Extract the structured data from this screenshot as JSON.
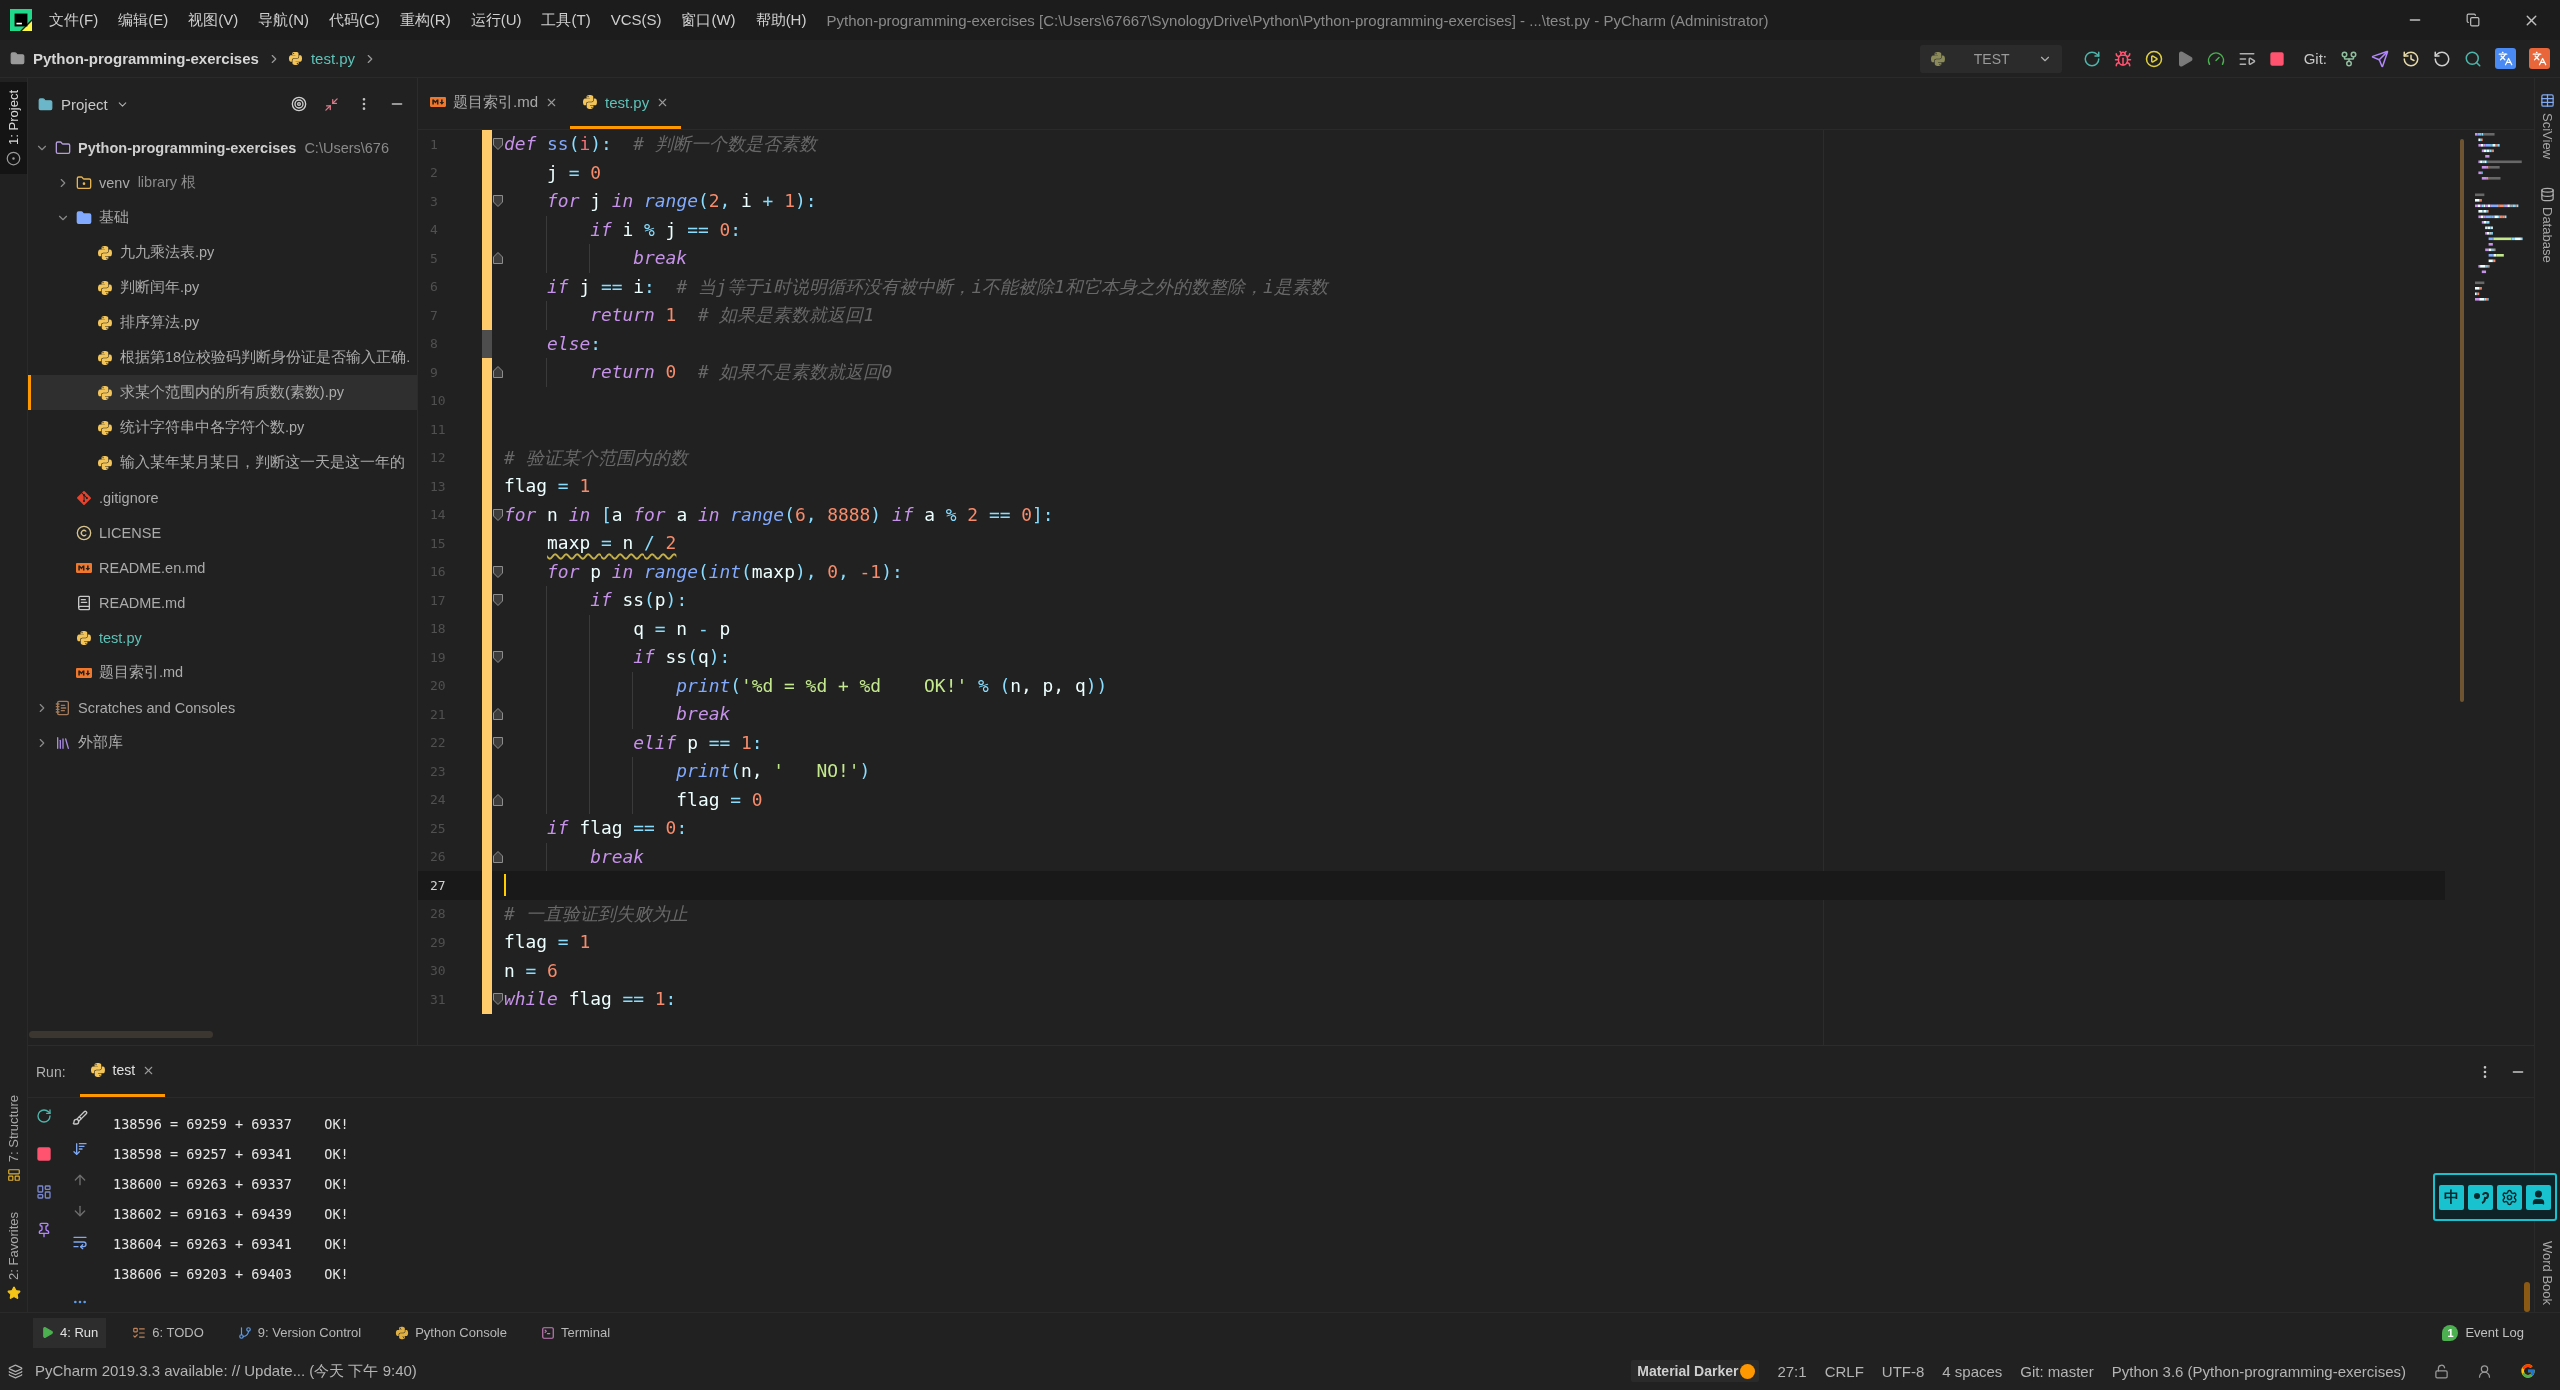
{
  "menu_bar": {
    "menus": [
      "文件(F)",
      "编辑(E)",
      "视图(V)",
      "导航(N)",
      "代码(C)",
      "重构(R)",
      "运行(U)",
      "工具(T)",
      "VCS(S)",
      "窗口(W)",
      "帮助(H)"
    ],
    "title": "Python-programming-exercises [C:\\Users\\67667\\SynologyDrive\\Python\\Python-programming-exercises] - ...\\test.py - PyCharm (Administrator)"
  },
  "nav_bar": {
    "breadcrumbs": [
      {
        "label": "Python-programming-exercises",
        "kind": "folder",
        "modified": false
      },
      {
        "label": "test.py",
        "kind": "python",
        "modified": true
      }
    ],
    "run_config": "TEST",
    "vcs_label": "Git:"
  },
  "left_stripe": {
    "top": [
      {
        "label": "1: Project",
        "selected": true
      }
    ],
    "bottom": [
      {
        "label": "7: Structure",
        "selected": false
      },
      {
        "label": "2: Favorites",
        "selected": false
      }
    ]
  },
  "right_stripe": {
    "top": [
      "SciView",
      "Database"
    ],
    "bottom": [
      "Word Book"
    ]
  },
  "project_panel": {
    "title": "Project",
    "tree": [
      {
        "label": "Python-programming-exercises",
        "path": "C:\\Users\\676",
        "kind": "module",
        "expanded": true,
        "selected": false,
        "modified": false,
        "children": [
          {
            "label": "venv",
            "note": "library 根",
            "kind": "excluded",
            "expanded": false,
            "selected": false,
            "modified": false
          },
          {
            "label": "基础",
            "kind": "folder",
            "expanded": true,
            "selected": false,
            "modified": false,
            "children": [
              {
                "label": "九九乘法表.py",
                "kind": "python",
                "selected": false,
                "modified": false
              },
              {
                "label": "判断闰年.py",
                "kind": "python",
                "selected": false,
                "modified": false
              },
              {
                "label": "排序算法.py",
                "kind": "python",
                "selected": false,
                "modified": false
              },
              {
                "label": "根据第18位校验码判断身份证是否输入正确.",
                "kind": "python",
                "selected": false,
                "modified": false
              },
              {
                "label": "求某个范围内的所有质数(素数).py",
                "kind": "python",
                "selected": true,
                "modified": false
              },
              {
                "label": "统计字符串中各字符个数.py",
                "kind": "python",
                "selected": false,
                "modified": false
              },
              {
                "label": "输入某年某月某日，判断这一天是这一年的",
                "kind": "python",
                "selected": false,
                "modified": false
              }
            ]
          },
          {
            "label": ".gitignore",
            "kind": "git",
            "selected": false,
            "modified": false
          },
          {
            "label": "LICENSE",
            "kind": "license",
            "selected": false,
            "modified": false
          },
          {
            "label": "README.en.md",
            "kind": "markdown",
            "selected": false,
            "modified": false
          },
          {
            "label": "README.md",
            "kind": "readme",
            "selected": false,
            "modified": false
          },
          {
            "label": "test.py",
            "kind": "python",
            "selected": false,
            "modified": true
          },
          {
            "label": "题目索引.md",
            "kind": "markdown",
            "selected": false,
            "modified": false
          }
        ]
      },
      {
        "label": "Scratches and Consoles",
        "kind": "scratches",
        "expanded": false,
        "selected": false,
        "modified": false
      },
      {
        "label": "外部库",
        "kind": "library",
        "expanded": false,
        "selected": false,
        "modified": false
      }
    ]
  },
  "editor": {
    "tabs": [
      {
        "label": "题目索引.md",
        "kind": "markdown",
        "selected": false,
        "modified": false
      },
      {
        "label": "test.py",
        "kind": "python",
        "selected": true,
        "modified": true
      }
    ],
    "lines": [
      {
        "number": "1",
        "current": false,
        "warning": false,
        "fold_marker": {
          "kind": "start"
        },
        "change_marker": {
          "color": "#ffcb6b"
        },
        "tokens": [
          {
            "kind": "keyword",
            "text": "def"
          },
          {
            "kind": "function",
            "text": " ss"
          },
          {
            "kind": "punct",
            "text": "("
          },
          {
            "kind": "param",
            "text": "i"
          },
          {
            "kind": "punct",
            "text": "):"
          },
          {
            "kind": "comment",
            "text": "  # 判断一个数是否素数"
          }
        ]
      },
      {
        "number": "2",
        "current": false,
        "warning": false,
        "change_marker": {
          "color": "#ffcb6b"
        },
        "tokens": [
          {
            "kind": "plain",
            "text": "    j "
          },
          {
            "kind": "punct",
            "text": "="
          },
          {
            "kind": "number",
            "text": " 0"
          }
        ]
      },
      {
        "number": "3",
        "current": false,
        "warning": false,
        "fold_marker": {
          "kind": "start"
        },
        "change_marker": {
          "color": "#ffcb6b"
        },
        "tokens": [
          {
            "kind": "keyword",
            "text": "    for"
          },
          {
            "kind": "plain",
            "text": " j "
          },
          {
            "kind": "keyword",
            "text": "in"
          },
          {
            "kind": "builtin",
            "text": " range"
          },
          {
            "kind": "punct",
            "text": "("
          },
          {
            "kind": "number",
            "text": "2"
          },
          {
            "kind": "punct",
            "text": ","
          },
          {
            "kind": "plain",
            "text": " i "
          },
          {
            "kind": "punct",
            "text": "+"
          },
          {
            "kind": "number",
            "text": " 1"
          },
          {
            "kind": "punct",
            "text": "):"
          }
        ]
      },
      {
        "number": "4",
        "current": false,
        "warning": false,
        "change_marker": {
          "color": "#ffcb6b"
        },
        "tokens": [
          {
            "kind": "keyword",
            "text": "        if"
          },
          {
            "kind": "plain",
            "text": " i "
          },
          {
            "kind": "punct",
            "text": "%"
          },
          {
            "kind": "plain",
            "text": " j "
          },
          {
            "kind": "punct",
            "text": "=="
          },
          {
            "kind": "number",
            "text": " 0"
          },
          {
            "kind": "punct",
            "text": ":"
          }
        ]
      },
      {
        "number": "5",
        "current": false,
        "warning": false,
        "fold_marker": {
          "kind": "end"
        },
        "change_marker": {
          "color": "#ffcb6b"
        },
        "tokens": [
          {
            "kind": "keyword",
            "text": "            break"
          }
        ]
      },
      {
        "number": "6",
        "current": false,
        "warning": false,
        "change_marker": {
          "color": "#ffcb6b"
        },
        "tokens": [
          {
            "kind": "keyword",
            "text": "    if"
          },
          {
            "kind": "plain",
            "text": " j "
          },
          {
            "kind": "punct",
            "text": "=="
          },
          {
            "kind": "plain",
            "text": " i"
          },
          {
            "kind": "punct",
            "text": ":"
          },
          {
            "kind": "comment",
            "text": "  # 当j等于i时说明循环没有被中断，i不能被除1和它本身之外的数整除，i是素数"
          }
        ]
      },
      {
        "number": "7",
        "current": false,
        "warning": false,
        "change_marker": {
          "color": "#ffcb6b"
        },
        "tokens": [
          {
            "kind": "keyword",
            "text": "        return"
          },
          {
            "kind": "number",
            "text": " 1"
          },
          {
            "kind": "comment",
            "text": "  # 如果是素数就返回1"
          }
        ]
      },
      {
        "number": "8",
        "current": false,
        "warning": false,
        "change_marker": {
          "color": "#4d4d4d"
        },
        "tokens": [
          {
            "kind": "keyword",
            "text": "    else"
          },
          {
            "kind": "punct",
            "text": ":"
          }
        ]
      },
      {
        "number": "9",
        "current": false,
        "warning": false,
        "fold_marker": {
          "kind": "end"
        },
        "change_marker": {
          "color": "#ffcb6b"
        },
        "tokens": [
          {
            "kind": "keyword",
            "text": "        return"
          },
          {
            "kind": "number",
            "text": " 0"
          },
          {
            "kind": "comment",
            "text": "  # 如果不是素数就返回0"
          }
        ]
      },
      {
        "number": "10",
        "current": false,
        "change_marker": {
          "color": "#ffcb6b"
        }
      },
      {
        "number": "11",
        "current": false,
        "change_marker": {
          "color": "#ffcb6b"
        }
      },
      {
        "number": "12",
        "current": false,
        "warning": false,
        "change_marker": {
          "color": "#ffcb6b"
        },
        "tokens": [
          {
            "kind": "comment",
            "text": "# 验证某个范围内的数"
          }
        ]
      },
      {
        "number": "13",
        "current": false,
        "warning": false,
        "change_marker": {
          "color": "#ffcb6b"
        },
        "tokens": [
          {
            "kind": "plain",
            "text": "flag "
          },
          {
            "kind": "punct",
            "text": "="
          },
          {
            "kind": "number",
            "text": " 1"
          }
        ]
      },
      {
        "number": "14",
        "current": false,
        "warning": false,
        "fold_marker": {
          "kind": "start"
        },
        "change_marker": {
          "color": "#ffcb6b"
        },
        "tokens": [
          {
            "kind": "keyword",
            "text": "for"
          },
          {
            "kind": "plain",
            "text": " n "
          },
          {
            "kind": "keyword",
            "text": "in"
          },
          {
            "kind": "punct",
            "text": " ["
          },
          {
            "kind": "plain",
            "text": "a "
          },
          {
            "kind": "keyword",
            "text": "for"
          },
          {
            "kind": "plain",
            "text": " a "
          },
          {
            "kind": "keyword",
            "text": "in"
          },
          {
            "kind": "builtin",
            "text": " range"
          },
          {
            "kind": "punct",
            "text": "("
          },
          {
            "kind": "number",
            "text": "6"
          },
          {
            "kind": "punct",
            "text": ","
          },
          {
            "kind": "number",
            "text": " 8888"
          },
          {
            "kind": "punct",
            "text": ")"
          },
          {
            "kind": "keyword",
            "text": " if"
          },
          {
            "kind": "plain",
            "text": " a "
          },
          {
            "kind": "punct",
            "text": "%"
          },
          {
            "kind": "number",
            "text": " 2"
          },
          {
            "kind": "punct",
            "text": " =="
          },
          {
            "kind": "number",
            "text": " 0"
          },
          {
            "kind": "punct",
            "text": "]:"
          }
        ]
      },
      {
        "number": "15",
        "current": false,
        "warning": true,
        "change_marker": {
          "color": "#ffcb6b"
        },
        "tokens": [
          {
            "kind": "plain",
            "text": "    maxp "
          },
          {
            "kind": "punct",
            "text": "="
          },
          {
            "kind": "plain",
            "text": " n "
          },
          {
            "kind": "punct",
            "text": "/"
          },
          {
            "kind": "number",
            "text": " 2"
          }
        ]
      },
      {
        "number": "16",
        "current": false,
        "warning": false,
        "fold_marker": {
          "kind": "start"
        },
        "change_marker": {
          "color": "#ffcb6b"
        },
        "tokens": [
          {
            "kind": "keyword",
            "text": "    for"
          },
          {
            "kind": "plain",
            "text": " p "
          },
          {
            "kind": "keyword",
            "text": "in"
          },
          {
            "kind": "builtin",
            "text": " range"
          },
          {
            "kind": "punct",
            "text": "("
          },
          {
            "kind": "builtin",
            "text": "int"
          },
          {
            "kind": "punct",
            "text": "("
          },
          {
            "kind": "plain",
            "text": "maxp"
          },
          {
            "kind": "punct",
            "text": "),"
          },
          {
            "kind": "number",
            "text": " 0"
          },
          {
            "kind": "punct",
            "text": ","
          },
          {
            "kind": "number",
            "text": " -1"
          },
          {
            "kind": "punct",
            "text": "):"
          }
        ]
      },
      {
        "number": "17",
        "current": false,
        "warning": false,
        "fold_marker": {
          "kind": "start"
        },
        "change_marker": {
          "color": "#ffcb6b"
        },
        "tokens": [
          {
            "kind": "keyword",
            "text": "        if"
          },
          {
            "kind": "plain",
            "text": " ss"
          },
          {
            "kind": "punct",
            "text": "("
          },
          {
            "kind": "plain",
            "text": "p"
          },
          {
            "kind": "punct",
            "text": "):"
          }
        ]
      },
      {
        "number": "18",
        "current": false,
        "warning": false,
        "change_marker": {
          "color": "#ffcb6b"
        },
        "tokens": [
          {
            "kind": "plain",
            "text": "            q "
          },
          {
            "kind": "punct",
            "text": "="
          },
          {
            "kind": "plain",
            "text": " n "
          },
          {
            "kind": "punct",
            "text": "-"
          },
          {
            "kind": "plain",
            "text": " p"
          }
        ]
      },
      {
        "number": "19",
        "current": false,
        "warning": false,
        "fold_marker": {
          "kind": "start"
        },
        "change_marker": {
          "color": "#ffcb6b"
        },
        "tokens": [
          {
            "kind": "keyword",
            "text": "            if"
          },
          {
            "kind": "plain",
            "text": " ss"
          },
          {
            "kind": "punct",
            "text": "("
          },
          {
            "kind": "plain",
            "text": "q"
          },
          {
            "kind": "punct",
            "text": "):"
          }
        ]
      },
      {
        "number": "20",
        "current": false,
        "warning": false,
        "change_marker": {
          "color": "#ffcb6b"
        },
        "tokens": [
          {
            "kind": "builtin",
            "text": "                print"
          },
          {
            "kind": "punct",
            "text": "("
          },
          {
            "kind": "string",
            "text": "'%d = %d + %d    OK!'"
          },
          {
            "kind": "punct",
            "text": " % ("
          },
          {
            "kind": "plain",
            "text": "n, p, q"
          },
          {
            "kind": "punct",
            "text": "))"
          }
        ]
      },
      {
        "number": "21",
        "current": false,
        "warning": false,
        "fold_marker": {
          "kind": "end"
        },
        "change_marker": {
          "color": "#ffcb6b"
        },
        "tokens": [
          {
            "kind": "keyword",
            "text": "                break"
          }
        ]
      },
      {
        "number": "22",
        "current": false,
        "warning": false,
        "fold_marker": {
          "kind": "start"
        },
        "change_marker": {
          "color": "#ffcb6b"
        },
        "tokens": [
          {
            "kind": "keyword",
            "text": "            elif"
          },
          {
            "kind": "plain",
            "text": " p "
          },
          {
            "kind": "punct",
            "text": "=="
          },
          {
            "kind": "number",
            "text": " 1"
          },
          {
            "kind": "punct",
            "text": ":"
          }
        ]
      },
      {
        "number": "23",
        "current": false,
        "warning": false,
        "change_marker": {
          "color": "#ffcb6b"
        },
        "tokens": [
          {
            "kind": "builtin",
            "text": "                print"
          },
          {
            "kind": "punct",
            "text": "("
          },
          {
            "kind": "plain",
            "text": "n, "
          },
          {
            "kind": "string",
            "text": "'   NO!'"
          },
          {
            "kind": "punct",
            "text": ")"
          }
        ]
      },
      {
        "number": "24",
        "current": false,
        "warning": false,
        "fold_marker": {
          "kind": "end"
        },
        "change_marker": {
          "color": "#ffcb6b"
        },
        "tokens": [
          {
            "kind": "plain",
            "text": "                flag "
          },
          {
            "kind": "punct",
            "text": "="
          },
          {
            "kind": "number",
            "text": " 0"
          }
        ]
      },
      {
        "number": "25",
        "current": false,
        "warning": false,
        "change_marker": {
          "color": "#ffcb6b"
        },
        "tokens": [
          {
            "kind": "keyword",
            "text": "    if"
          },
          {
            "kind": "plain",
            "text": " flag "
          },
          {
            "kind": "punct",
            "text": "=="
          },
          {
            "kind": "number",
            "text": " 0"
          },
          {
            "kind": "punct",
            "text": ":"
          }
        ]
      },
      {
        "number": "26",
        "current": false,
        "warning": false,
        "fold_marker": {
          "kind": "end"
        },
        "change_marker": {
          "color": "#ffcb6b"
        },
        "tokens": [
          {
            "kind": "keyword",
            "text": "        break"
          }
        ]
      },
      {
        "number": "27",
        "current": true,
        "change_marker": {
          "color": "#ffcb6b"
        }
      },
      {
        "number": "28",
        "current": false,
        "warning": false,
        "change_marker": {
          "color": "#ffcb6b"
        },
        "tokens": [
          {
            "kind": "comment",
            "text": "# 一直验证到失败为止"
          }
        ]
      },
      {
        "number": "29",
        "current": false,
        "warning": false,
        "change_marker": {
          "color": "#ffcb6b"
        },
        "tokens": [
          {
            "kind": "plain",
            "text": "flag "
          },
          {
            "kind": "punct",
            "text": "="
          },
          {
            "kind": "number",
            "text": " 1"
          }
        ]
      },
      {
        "number": "30",
        "current": false,
        "warning": false,
        "change_marker": {
          "color": "#ffcb6b"
        },
        "tokens": [
          {
            "kind": "plain",
            "text": "n "
          },
          {
            "kind": "punct",
            "text": "="
          },
          {
            "kind": "number",
            "text": " 6"
          }
        ]
      },
      {
        "number": "31",
        "current": false,
        "warning": false,
        "fold_marker": {
          "kind": "start"
        },
        "change_marker": {
          "color": "#ffcb6b"
        },
        "tokens": [
          {
            "kind": "keyword",
            "text": "while"
          },
          {
            "kind": "plain",
            "text": " flag "
          },
          {
            "kind": "punct",
            "text": "=="
          },
          {
            "kind": "number",
            "text": " 1"
          },
          {
            "kind": "punct",
            "text": ":"
          }
        ]
      }
    ]
  },
  "run_panel": {
    "label": "Run:",
    "tabs": [
      {
        "label": "test",
        "selected": true
      }
    ],
    "output": [
      "138596 = 69259 + 69337    OK!",
      "138598 = 69257 + 69341    OK!",
      "138600 = 69263 + 69337    OK!",
      "138602 = 69163 + 69439    OK!",
      "138604 = 69263 + 69341    OK!",
      "138606 = 69203 + 69403    OK!"
    ]
  },
  "tool_tabs": {
    "tabs": [
      {
        "label": "4: Run",
        "kind": "run",
        "selected": true
      },
      {
        "label": "6: TODO",
        "kind": "todo",
        "selected": false
      },
      {
        "label": "9: Version Control",
        "kind": "vcs",
        "selected": false
      },
      {
        "label": "Python Console",
        "kind": "python_console",
        "selected": false
      },
      {
        "label": "Terminal",
        "kind": "terminal",
        "selected": false
      }
    ],
    "event_count": "1",
    "event_log": "Event Log"
  },
  "ime_toolbar": {
    "mode": "中"
  },
  "status_bar": {
    "message": "PyCharm 2019.3.3 available: // Update... (今天 下午 9:40)",
    "theme": "Material Darker",
    "items": [
      "27:1",
      "CRLF",
      "UTF-8",
      "4 spaces",
      "Git: master",
      "Python 3.6 (Python-programming-exercises)"
    ]
  }
}
